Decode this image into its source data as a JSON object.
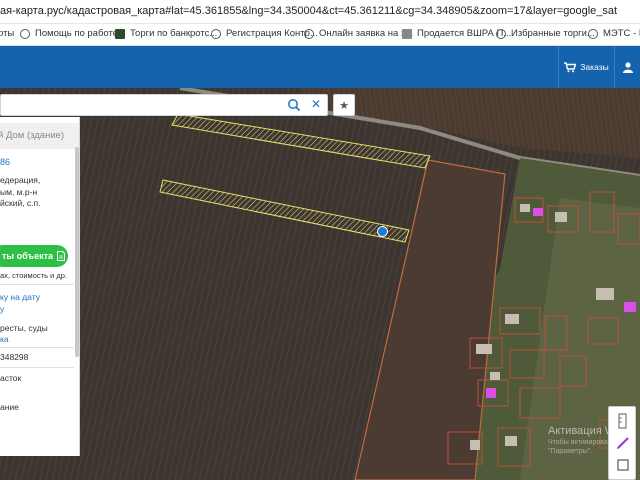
{
  "browser": {
    "url": "ая-карта.рус/кадастровая_карта#lat=45.361855&lng=34.350004&ct=45.361211&cg=34.348905&zoom=17&layer=google_sat"
  },
  "bookmarks": [
    {
      "label": "рты",
      "icon": "none"
    },
    {
      "label": "Помощь по работе...",
      "icon": "globe-icon"
    },
    {
      "label": "Торги по банкротс...",
      "icon": "hammer-icon"
    },
    {
      "label": "Регистрация Контр...",
      "icon": "globe-icon"
    },
    {
      "label": "Онлайн заявка на з...",
      "icon": "globe-icon"
    },
    {
      "label": "Продается ВШРА П...",
      "icon": "doc-icon"
    },
    {
      "label": "Избранные торги...",
      "icon": "globe-icon"
    },
    {
      "label": "МЭТС - Ин",
      "icon": "globe-icon"
    }
  ],
  "nav": {
    "orders_label": "Заказы",
    "orders_icon": "cart-icon",
    "user_label": "",
    "user_icon": "user-icon",
    "bar_color": "#1562ad"
  },
  "search": {
    "value": "",
    "placeholder": ""
  },
  "panel": {
    "title": "й Дом (здание)",
    "id": "86",
    "address_lines": [
      "едерация,",
      "ым, м.р-н",
      "йский, с.п."
    ],
    "button_label": "ты объекта",
    "button_icon": "document-icon",
    "note": "ах, стоимость и др.",
    "link1_lines": [
      "ку на дату",
      "у"
    ],
    "text2": "ресты, суды",
    "link2": "ка",
    "number": "348298",
    "text3": "асток",
    "text4": "ание",
    "accent_color": "#2ebf46",
    "link_color": "#1e73c2"
  },
  "map": {
    "layer": "google_sat",
    "zoom": 17,
    "watermark_line1": "Активация Windo",
    "watermark_line2a": "Чтобы активирова",
    "watermark_line2b": "\"Параметры\"."
  },
  "map_tools": [
    {
      "icon": "ruler-icon"
    },
    {
      "icon": "pencil-icon"
    },
    {
      "icon": "square-icon"
    }
  ]
}
